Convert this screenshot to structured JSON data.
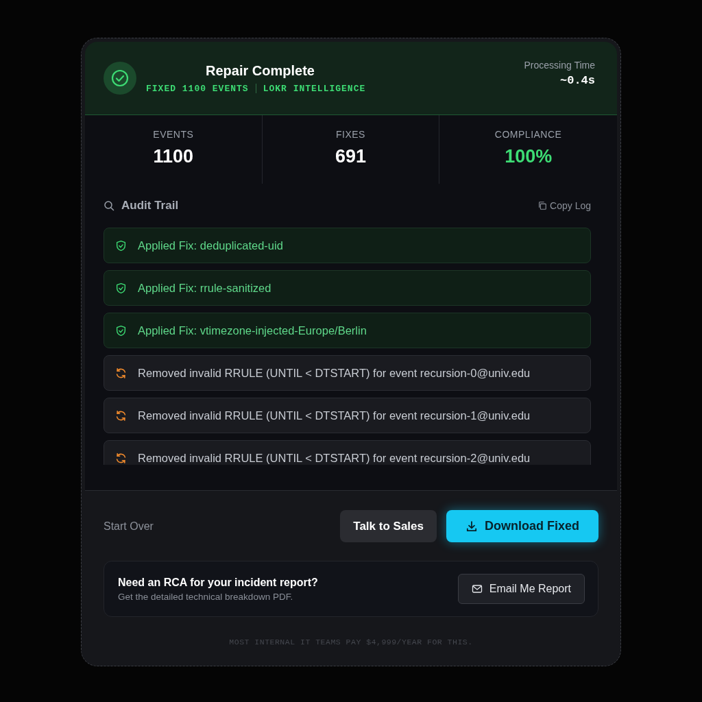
{
  "header": {
    "title": "Repair Complete",
    "subtitle_left": "FIXED 1100 EVENTS",
    "subtitle_right": "LOKR INTELLIGENCE",
    "time_label": "Processing Time",
    "time_value": "~0.4s"
  },
  "stats": [
    {
      "label": "EVENTS",
      "value": "1100",
      "kind": "plain"
    },
    {
      "label": "FIXES",
      "value": "691",
      "kind": "plain"
    },
    {
      "label": "COMPLIANCE",
      "value": "100%",
      "kind": "success"
    }
  ],
  "audit": {
    "title": "Audit Trail",
    "copy_label": "Copy Log",
    "entries": [
      {
        "kind": "fix",
        "text": "Applied Fix: deduplicated-uid"
      },
      {
        "kind": "fix",
        "text": "Applied Fix: rrule-sanitized"
      },
      {
        "kind": "fix",
        "text": "Applied Fix: vtimezone-injected-Europe/Berlin"
      },
      {
        "kind": "removed",
        "text": "Removed invalid RRULE (UNTIL < DTSTART) for event recursion-0@univ.edu"
      },
      {
        "kind": "removed",
        "text": "Removed invalid RRULE (UNTIL < DTSTART) for event recursion-1@univ.edu"
      },
      {
        "kind": "removed",
        "text": "Removed invalid RRULE (UNTIL < DTSTART) for event recursion-2@univ.edu"
      }
    ]
  },
  "actions": {
    "start_over": "Start Over",
    "talk": "Talk to Sales",
    "download": "Download Fixed"
  },
  "rca": {
    "title": "Need an RCA for your incident report?",
    "subtitle": "Get the detailed technical breakdown PDF.",
    "button": "Email Me Report"
  },
  "footnote": "MOST INTERNAL IT TEAMS PAY $4,999/YEAR FOR THIS."
}
